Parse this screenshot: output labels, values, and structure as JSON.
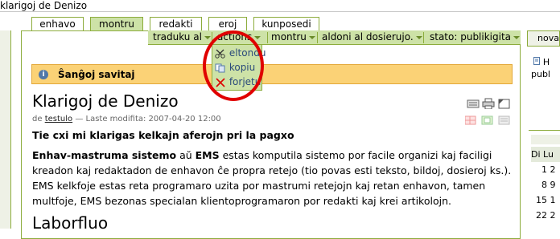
{
  "window": {
    "title": "klarigoj de Denizo"
  },
  "tabs": [
    {
      "label": "enhavo"
    },
    {
      "label": "montru"
    },
    {
      "label": "redakti"
    },
    {
      "label": "eroj"
    },
    {
      "label": "kunposedi"
    }
  ],
  "actionbar": {
    "translate": "traduku al",
    "actions": "actions",
    "display": "montru",
    "add": "aldoni al dosierujo.",
    "state": "stato: publikigita"
  },
  "actions_menu": {
    "items": [
      {
        "label": "eltondu",
        "icon": "scissors-icon"
      },
      {
        "label": "kopiu",
        "icon": "copy-icon"
      },
      {
        "label": "forjetu",
        "icon": "delete-icon"
      }
    ]
  },
  "info": {
    "message": "Ŝanĝoj savitaj"
  },
  "document": {
    "title": "Klarigoj de Denizo",
    "byline_prefix": "de",
    "author": "testulo",
    "modified": "— Laste modifita: 2007-04-20 12:00",
    "description": "Tie cxi mi klarigas kelkajn aferojn pri la pagxo",
    "para_bold1": "Enhav-mastruma sistemo",
    "para_mid": " aŭ ",
    "para_bold2": "EMS",
    "para_rest": " estas komputila sistemo por facile organizi kaj faciligi kreadon kaj redaktadon de enhavon ĉe propra retejo (tio povas esti teksto, bildoj, dosieroj ks.). EMS kelkfoje estas reta programaro uzita por mastrumi retejojn kaj retan enhavon, tamen multfoje, EMS bezonas specialan klientoprogramaron por redakti kaj krei artikolojn.",
    "section_heading": "Laborfluo"
  },
  "right_column": {
    "panel_title": "nova",
    "line1": "H",
    "line2": "publ",
    "calendar": {
      "days_header": "Di  Lu",
      "rows": [
        {
          "a": "1",
          "b": "2"
        },
        {
          "a": "8",
          "b": "9"
        },
        {
          "a": "15",
          "b": "1"
        },
        {
          "a": "22",
          "b": "2"
        }
      ]
    }
  },
  "colors": {
    "accent": "#8cac3c",
    "tab_active": "#cde2a7",
    "info_bg": "#fbd276",
    "annotation": "#e00000"
  }
}
